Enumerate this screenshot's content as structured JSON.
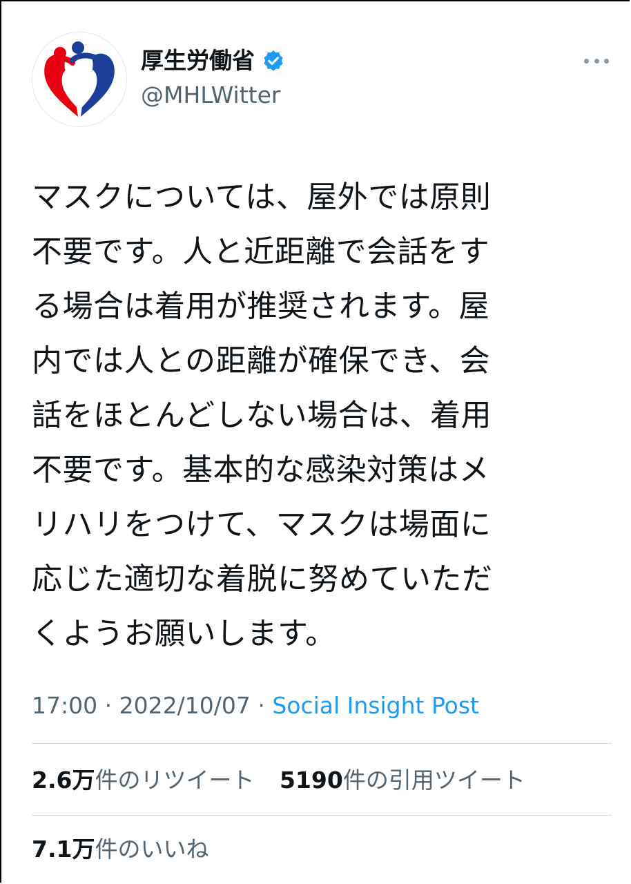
{
  "account": {
    "display_name": "厚生労働省",
    "handle": "@MHLWitter",
    "verified_color": "#1d9bf0",
    "avatar_icon": "mhlw-logo-icon"
  },
  "tweet": {
    "text": "マスクについては、屋外では原則\n不要です。人と近距離で会話をす\nる場合は着用が推奨されます。屋\n内では人との距離が確保でき、会\n話をほとんどしない場合は、着用\n不要です。基本的な感染対策はメ\nリハリをつけて、マスクは場面に\n応じた適切な着脱に努めていただ\nくようお願いします。",
    "time": "17:00",
    "date": "2022/10/07",
    "separator": "·",
    "source": "Social Insight Post"
  },
  "stats": {
    "retweets_num": "2.6",
    "retweets_unit": "万",
    "retweets_label": "件のリツイート",
    "quotes_num": "5190",
    "quotes_label": "件の引用ツイート",
    "likes_num": "7.1",
    "likes_unit": "万",
    "likes_label": "件のいいね"
  },
  "colors": {
    "text": "#0f1419",
    "muted": "#536471",
    "link": "#1d9bf0",
    "logo_red": "#e60012",
    "logo_blue": "#1d3f9a"
  }
}
